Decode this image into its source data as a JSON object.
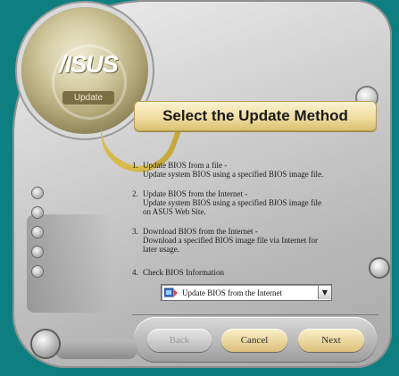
{
  "window": {
    "logo_text": "/ISUS",
    "badge_text": "Update",
    "title": "Select the Update Method"
  },
  "options": [
    {
      "num": "1.",
      "lines": [
        "Update BIOS from a file -",
        "Update system BIOS using a specified BIOS image file."
      ]
    },
    {
      "num": "2.",
      "lines": [
        "Update BIOS from the Internet -",
        "Update system BIOS using a specified BIOS image file",
        "on ASUS Web Site."
      ]
    },
    {
      "num": "3.",
      "lines": [
        "Download BIOS from the Internet -",
        "Download a specified BIOS image file via Internet for",
        "later usage."
      ]
    },
    {
      "num": "4.",
      "lines": [
        "Check BIOS Information"
      ]
    }
  ],
  "select": {
    "value": "Update BIOS from the Internet",
    "arrow": "▼"
  },
  "buttons": {
    "back": "Back",
    "cancel": "Cancel",
    "next": "Next"
  },
  "colors": {
    "background": "#0d7f80",
    "accent_gold": "#e6cf84"
  }
}
